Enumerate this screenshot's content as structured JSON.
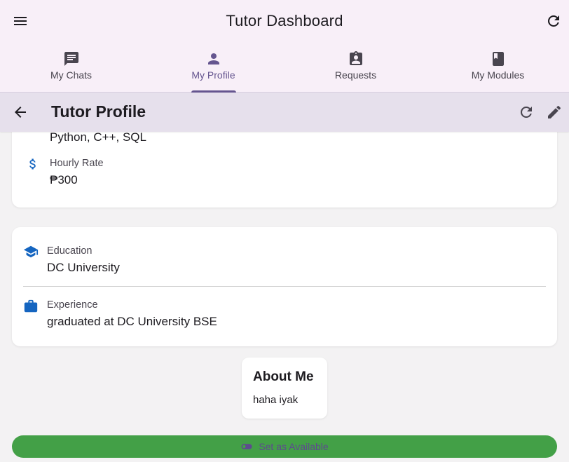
{
  "app": {
    "title": "Tutor Dashboard"
  },
  "tabs": [
    {
      "label": "My Chats",
      "icon": "chat-icon",
      "active": false
    },
    {
      "label": "My Profile",
      "icon": "person-icon",
      "active": true
    },
    {
      "label": "Requests",
      "icon": "assignment-ind-icon",
      "active": false
    },
    {
      "label": "My Modules",
      "icon": "book-icon",
      "active": false
    }
  ],
  "subbar": {
    "title": "Tutor Profile"
  },
  "profile": {
    "skills_value": "Python, C++, SQL",
    "hourly_rate": {
      "label": "Hourly Rate",
      "value": "₱300"
    },
    "education": {
      "label": "Education",
      "value": "DC University"
    },
    "experience": {
      "label": "Experience",
      "value": "graduated at DC University BSE"
    }
  },
  "about": {
    "title": "About Me",
    "text": "haha iyak"
  },
  "availability_button": {
    "label": "Set as Available"
  },
  "colors": {
    "accent": "#65558f",
    "icon_blue": "#1565c0",
    "button_green": "#43a047",
    "header_bg": "#f8eff8",
    "subbar_bg": "#e6e0ec"
  }
}
